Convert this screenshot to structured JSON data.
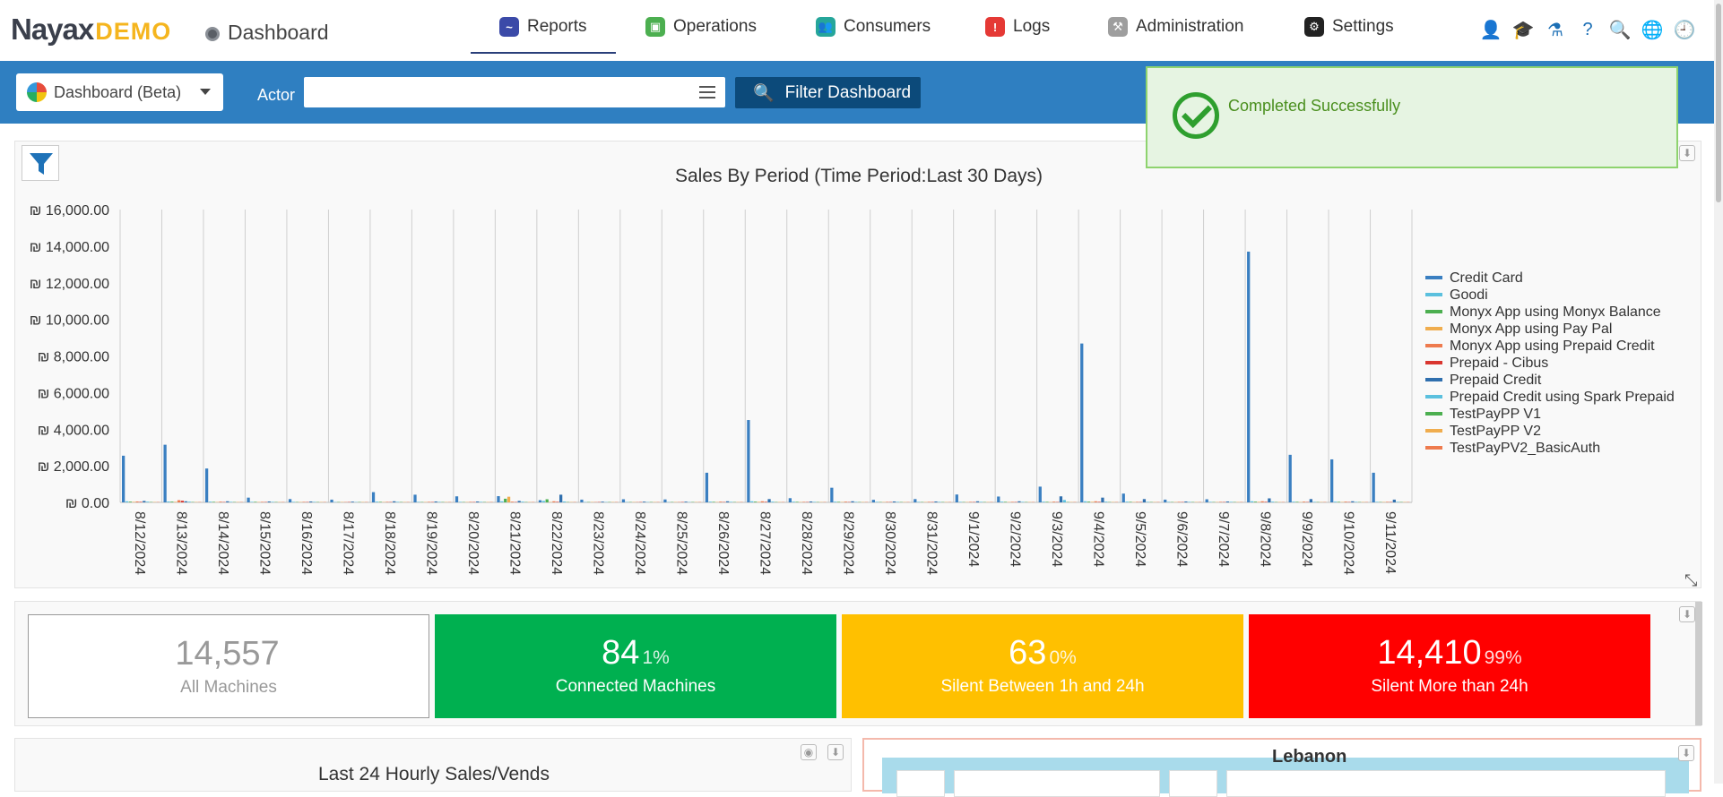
{
  "app": {
    "logo_main": "Nayax",
    "logo_badge": "DEMO",
    "page_title": "Dashboard"
  },
  "nav": {
    "items": [
      {
        "label": "Reports",
        "icon": "reports-icon",
        "color": "#3b4aa8",
        "active": true
      },
      {
        "label": "Operations",
        "icon": "operations-icon",
        "color": "#4caf50",
        "active": false
      },
      {
        "label": "Consumers",
        "icon": "consumers-icon",
        "color": "#26a69a",
        "active": false
      },
      {
        "label": "Logs",
        "icon": "logs-icon",
        "color": "#e53935",
        "active": false
      },
      {
        "label": "Administration",
        "icon": "administration-icon",
        "color": "#9e9e9e",
        "active": false
      },
      {
        "label": "Settings",
        "icon": "settings-icon",
        "color": "#222222",
        "active": false
      }
    ]
  },
  "toolbar": {
    "dashboard_select": "Dashboard (Beta)",
    "actor_label": "Actor",
    "actor_value": "",
    "filter_button": "Filter Dashboard"
  },
  "toast": {
    "message": "Completed Successfully"
  },
  "chart_data": {
    "type": "bar",
    "title": "Sales By Period (Time Period:Last 30 Days)",
    "xlabel": "",
    "ylabel": "",
    "ylim": [
      0,
      16000
    ],
    "yticks": [
      "₪ 0.00",
      "₪ 2,000.00",
      "₪ 4,000.00",
      "₪ 6,000.00",
      "₪ 8,000.00",
      "₪ 10,000.00",
      "₪ 12,000.00",
      "₪ 14,000.00",
      "₪ 16,000.00"
    ],
    "grid": "vertical",
    "legend_position": "right",
    "categories": [
      "8/12/2024",
      "8/13/2024",
      "8/14/2024",
      "8/15/2024",
      "8/16/2024",
      "8/17/2024",
      "8/18/2024",
      "8/19/2024",
      "8/20/2024",
      "8/21/2024",
      "8/22/2024",
      "8/23/2024",
      "8/24/2024",
      "8/25/2024",
      "8/26/2024",
      "8/27/2024",
      "8/28/2024",
      "8/29/2024",
      "8/30/2024",
      "8/31/2024",
      "9/1/2024",
      "9/2/2024",
      "9/3/2024",
      "9/4/2024",
      "9/5/2024",
      "9/6/2024",
      "9/7/2024",
      "9/8/2024",
      "9/9/2024",
      "9/10/2024",
      "9/11/2024"
    ],
    "series": [
      {
        "name": "Credit Card",
        "color": "#3a7fc1",
        "values": [
          2550,
          3150,
          1850,
          260,
          180,
          150,
          560,
          420,
          330,
          340,
          120,
          150,
          170,
          160,
          1620,
          4500,
          230,
          800,
          140,
          180,
          430,
          320,
          860,
          8680,
          480,
          150,
          170,
          13700,
          2600,
          2350,
          1620
        ]
      },
      {
        "name": "Goodi",
        "color": "#5bc0de",
        "values": [
          60,
          50,
          40,
          30,
          30,
          20,
          40,
          30,
          30,
          60,
          80,
          20,
          20,
          20,
          40,
          60,
          40,
          40,
          30,
          30,
          30,
          40,
          40,
          60,
          40,
          30,
          30,
          60,
          40,
          40,
          30
        ]
      },
      {
        "name": "Monyx App using Monyx Balance",
        "color": "#4caf50",
        "values": [
          40,
          40,
          30,
          30,
          20,
          20,
          30,
          20,
          20,
          200,
          170,
          20,
          20,
          20,
          30,
          40,
          30,
          30,
          20,
          20,
          20,
          30,
          30,
          40,
          30,
          20,
          20,
          40,
          30,
          30,
          20
        ]
      },
      {
        "name": "Monyx App using Pay Pal",
        "color": "#f0ad4e",
        "values": [
          30,
          30,
          20,
          20,
          20,
          20,
          20,
          20,
          20,
          310,
          20,
          20,
          20,
          20,
          20,
          30,
          20,
          20,
          20,
          20,
          20,
          20,
          20,
          30,
          20,
          20,
          20,
          30,
          20,
          20,
          20
        ]
      },
      {
        "name": "Monyx App using Prepaid Credit",
        "color": "#ee7b4e",
        "values": [
          50,
          120,
          40,
          30,
          30,
          20,
          30,
          30,
          30,
          40,
          60,
          20,
          20,
          20,
          40,
          60,
          30,
          40,
          30,
          30,
          30,
          30,
          40,
          60,
          30,
          30,
          30,
          60,
          40,
          40,
          30
        ]
      },
      {
        "name": "Prepaid - Cibus",
        "color": "#d9362f",
        "values": [
          30,
          90,
          20,
          20,
          20,
          20,
          20,
          20,
          20,
          20,
          30,
          20,
          20,
          20,
          20,
          30,
          20,
          20,
          20,
          20,
          20,
          20,
          20,
          30,
          20,
          20,
          20,
          30,
          20,
          20,
          20
        ]
      },
      {
        "name": "Prepaid Credit",
        "color": "#2f6fae",
        "values": [
          80,
          60,
          60,
          50,
          50,
          40,
          60,
          50,
          50,
          80,
          420,
          40,
          40,
          40,
          60,
          180,
          50,
          60,
          50,
          50,
          60,
          60,
          330,
          260,
          180,
          50,
          50,
          220,
          180,
          60,
          150
        ]
      },
      {
        "name": "Prepaid Credit using Spark Prepaid",
        "color": "#5bc0de",
        "values": [
          40,
          40,
          30,
          30,
          30,
          20,
          30,
          30,
          30,
          40,
          50,
          20,
          20,
          20,
          30,
          40,
          30,
          30,
          30,
          30,
          30,
          30,
          130,
          40,
          30,
          30,
          30,
          40,
          30,
          30,
          30
        ]
      },
      {
        "name": "TestPayPP V1",
        "color": "#4caf50",
        "values": [
          20,
          20,
          20,
          20,
          20,
          20,
          20,
          20,
          20,
          20,
          20,
          20,
          20,
          20,
          20,
          20,
          20,
          20,
          20,
          20,
          20,
          20,
          20,
          20,
          20,
          20,
          20,
          20,
          20,
          20,
          20
        ]
      },
      {
        "name": "TestPayPP V2",
        "color": "#f0ad4e",
        "values": [
          20,
          20,
          20,
          20,
          20,
          20,
          20,
          20,
          20,
          20,
          20,
          20,
          20,
          20,
          20,
          20,
          20,
          20,
          20,
          20,
          20,
          20,
          20,
          20,
          20,
          20,
          20,
          20,
          20,
          20,
          20
        ]
      },
      {
        "name": "TestPayPV2_BasicAuth",
        "color": "#ee7b4e",
        "values": [
          20,
          20,
          20,
          20,
          20,
          20,
          20,
          20,
          20,
          20,
          20,
          20,
          20,
          20,
          20,
          20,
          20,
          20,
          20,
          20,
          20,
          20,
          20,
          20,
          20,
          20,
          20,
          20,
          20,
          20,
          20
        ]
      }
    ]
  },
  "stats": [
    {
      "value": "14,557",
      "percent": "",
      "label": "All Machines"
    },
    {
      "value": "84",
      "percent": "1%",
      "label": "Connected Machines"
    },
    {
      "value": "63",
      "percent": "0%",
      "label": "Silent Between 1h and 24h"
    },
    {
      "value": "14,410",
      "percent": "99%",
      "label": "Silent More than 24h"
    }
  ],
  "hourly": {
    "title": "Last 24 Hourly Sales/Vends"
  },
  "map": {
    "label": "Lebanon"
  }
}
